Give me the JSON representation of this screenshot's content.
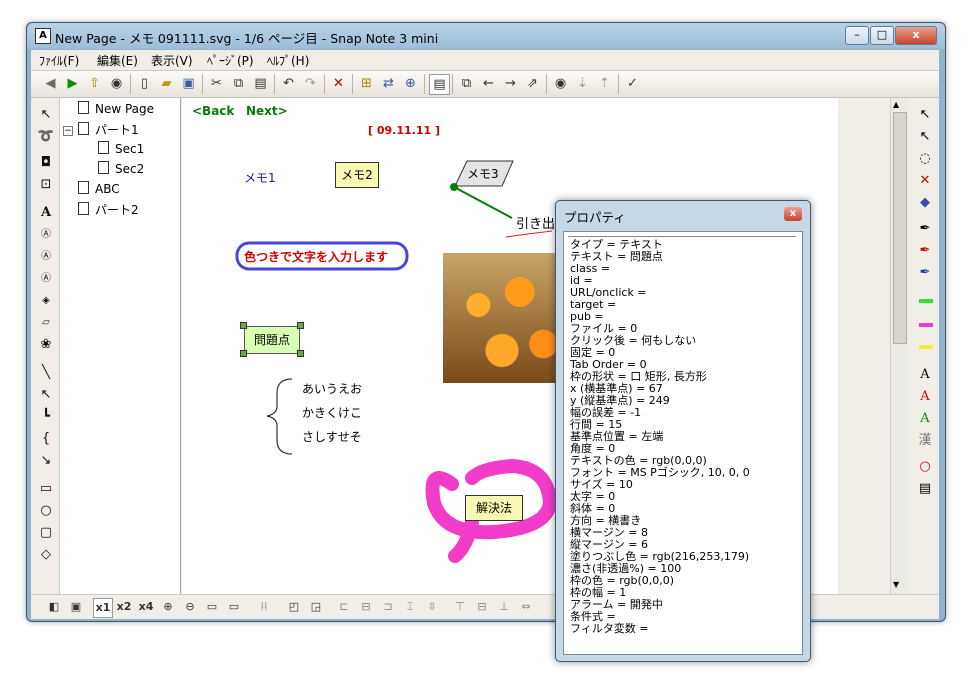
{
  "window": {
    "title": "New Page - メモ 091111.svg - 1/6 ページ目 - Snap Note 3 mini",
    "app_icon": "A",
    "controls": {
      "minimize": "–",
      "maximize": "□",
      "close": "x"
    }
  },
  "menu": [
    "ﾌｧｲﾙ(F)",
    "編集(E)",
    "表示(V)",
    "ﾍﾟｰｼﾞ(P)",
    "ﾍﾙﾌﾟ(H)"
  ],
  "tree": {
    "items": [
      {
        "label": "New Page"
      },
      {
        "label": "パート1"
      },
      {
        "label": "Sec1"
      },
      {
        "label": "Sec2"
      },
      {
        "label": "ABC"
      },
      {
        "label": "パート2"
      }
    ]
  },
  "canvas": {
    "back": "<Back",
    "next": "Next>",
    "date": "[ 09.11.11 ]",
    "memo1": "メモ1",
    "memo2": "メモ2",
    "memo3": "メモ3",
    "callout": "引き出し",
    "colored_text": "色つきで文字を入力します",
    "issue": "問題点",
    "bracket_lines": [
      "あいうえお",
      "かきくけこ",
      "さしすせそ"
    ],
    "solution": "解決法"
  },
  "bottom_bar": {
    "zoom1": "x1",
    "zoom2": "x2",
    "zoom4": "x4"
  },
  "properties": {
    "title": "プロパティ",
    "close": "x",
    "lines": [
      "タイプ = テキスト",
      "テキスト = 問題点",
      "class =",
      "id =",
      "URL/onclick =",
      "target =",
      "pub =",
      "ファイル = 0",
      "クリック後 = 何もしない",
      "固定 = 0",
      "Tab Order = 0",
      "枠の形状 = 口 矩形, 長方形",
      "x (横基準点) = 67",
      "y (縦基準点) = 249",
      "幅の誤差 = -1",
      "行間 = 15",
      "基準点位置 = 左端",
      "角度 = 0",
      "テキストの色 = rgb(0,0,0)",
      "フォント = MS Pゴシック, 10, 0, 0",
      "サイズ = 10",
      "太字 = 0",
      "斜体 = 0",
      "方向 = 横書き",
      "横マージン = 8",
      "縦マージン = 6",
      "塗りつぶし色 = rgb(216,253,179)",
      "濃さ(非透過%) = 100",
      "枠の色 = rgb(0,0,0)",
      "枠の幅 = 1",
      "アラーム = 開発中",
      "条件式 =",
      "フィルタ変数 ="
    ]
  },
  "colors": {
    "accent_green": "#0a7a0a",
    "date_red": "#d40000",
    "memo1_blue": "#1a1aa8",
    "highlight_pink": "#f03cc8",
    "issue_fill": "#d8fdb3",
    "callout_line": "#008000"
  }
}
